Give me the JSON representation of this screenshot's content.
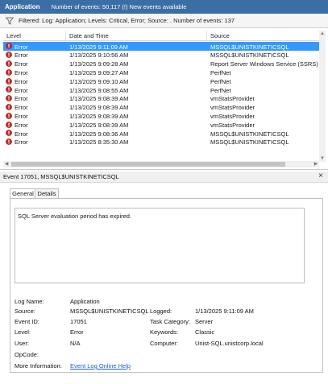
{
  "header": {
    "title": "Application",
    "events_text": "Number of events: 50,117 (!) New events available"
  },
  "filter": {
    "text": "Filtered: Log: Application; Levels: Critical, Error; Source: . Number of events: 137"
  },
  "columns": {
    "level": "Level",
    "datetime": "Date and Time",
    "source": "Source"
  },
  "rows": [
    {
      "level": "Error",
      "datetime": "1/13/2025 9:11:09 AM",
      "source": "MSSQL$UNISTKINETICSQL"
    },
    {
      "level": "Error",
      "datetime": "1/13/2025 9:10:56 AM",
      "source": "MSSQL$UNISTKINETICSQL"
    },
    {
      "level": "Error",
      "datetime": "1/13/2025 9:09:28 AM",
      "source": "Report Server Windows Service (SSRS)"
    },
    {
      "level": "Error",
      "datetime": "1/13/2025 9:09:27 AM",
      "source": "PerfNet"
    },
    {
      "level": "Error",
      "datetime": "1/13/2025 9:09:10 AM",
      "source": "PerfNet"
    },
    {
      "level": "Error",
      "datetime": "1/13/2025 9:08:55 AM",
      "source": "PerfNet"
    },
    {
      "level": "Error",
      "datetime": "1/13/2025 9:08:39 AM",
      "source": "vmStatsProvider"
    },
    {
      "level": "Error",
      "datetime": "1/13/2025 9:08:39 AM",
      "source": "vmStatsProvider"
    },
    {
      "level": "Error",
      "datetime": "1/13/2025 9:08:39 AM",
      "source": "vmStatsProvider"
    },
    {
      "level": "Error",
      "datetime": "1/13/2025 9:08:39 AM",
      "source": "vmStatsProvider"
    },
    {
      "level": "Error",
      "datetime": "1/13/2025 9:08:36 AM",
      "source": "MSSQL$UNISTKINETICSQL"
    },
    {
      "level": "Error",
      "datetime": "1/13/2025 8:35:30 AM",
      "source": "MSSQL$UNISTKINETICSQL"
    }
  ],
  "event": {
    "title": "Event 17051, MSSQL$UNISTKINETICSQL",
    "close_glyph": "×",
    "tabs": [
      "General",
      "Details"
    ],
    "description": "SQL Server evaluation period has expired.",
    "labels": {
      "log_name": "Log Name:",
      "source": "Source:",
      "event_id": "Event ID:",
      "level": "Level:",
      "user": "User:",
      "opcode": "OpCode:",
      "more_info": "More Information:",
      "logged": "Logged:",
      "task_category": "Task Category:",
      "keywords": "Keywords:",
      "computer": "Computer:"
    },
    "values": {
      "log_name": "Application",
      "source": "MSSQL$UNISTKINETICSQL",
      "event_id": "17051",
      "level": "Error",
      "user": "N/A",
      "opcode": "",
      "more_info": "Event Log Online Help",
      "logged": "1/13/2025 9:11:09 AM",
      "task_category": "Server",
      "keywords": "Classic",
      "computer": "Unist-SQL.unistcorp.local"
    }
  },
  "colors": {
    "header_bg": "#3a6ea5",
    "selection": "#3399ff",
    "error_icon": "#c62828",
    "link": "#1a5fd1"
  },
  "icons": {
    "filter": "filter-icon",
    "error": "error-icon",
    "close": "close-icon"
  }
}
